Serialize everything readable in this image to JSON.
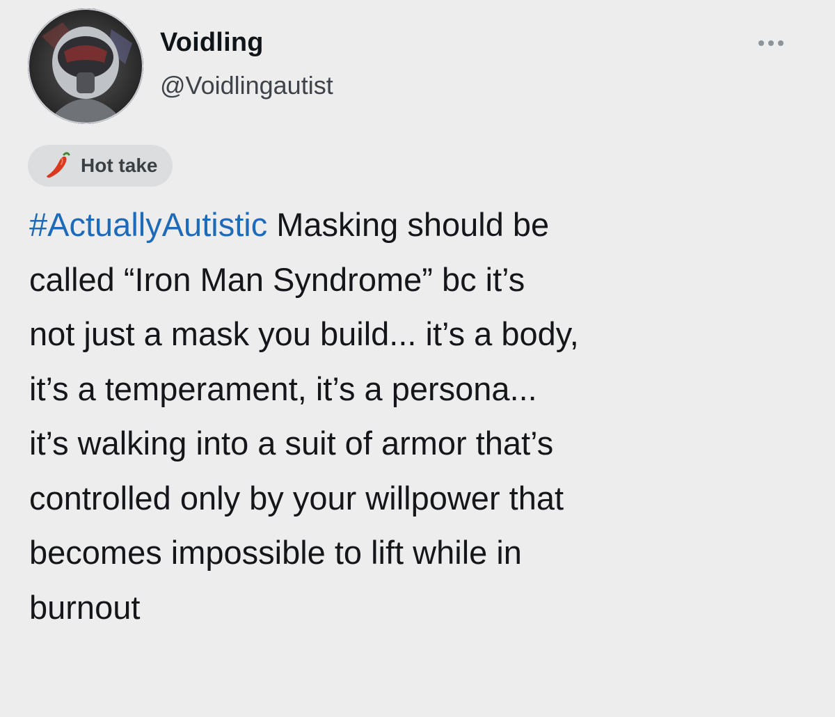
{
  "author": {
    "display_name": "Voidling",
    "handle": "@Voidlingautist",
    "avatar_icon": "helmeted-pilot-avatar"
  },
  "menu": {
    "icon": "more-horizontal-icon"
  },
  "badge": {
    "icon": "chili-pepper-icon",
    "label": "Hot take",
    "color": "#d93a1f"
  },
  "tweet": {
    "hashtag": "#ActuallyAutistic",
    "hashtag_color": "#1d6ab8",
    "lines": [
      " Masking should be",
      "called “Iron Man Syndrome” bc it’s",
      "not just a mask you build... it’s a body,",
      "it’s a temperament, it’s a persona...",
      "it’s walking into a suit of armor that’s",
      "controlled only by your willpower that",
      "becomes impossible to lift while in",
      "burnout"
    ]
  }
}
